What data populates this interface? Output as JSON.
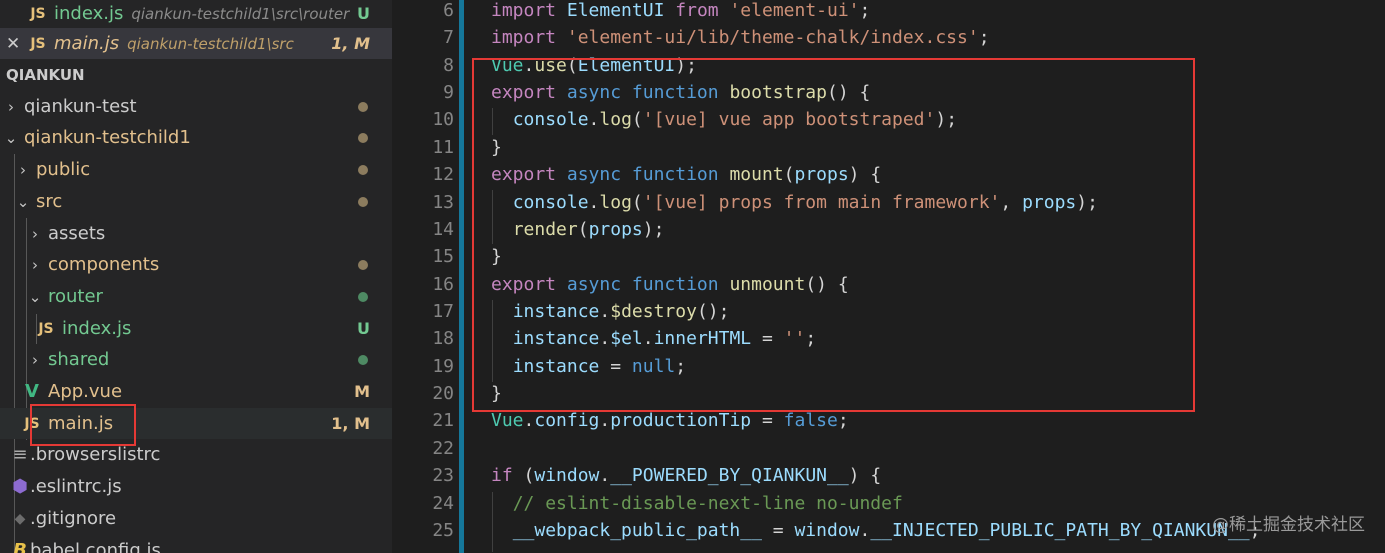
{
  "colors": {
    "keyword": "#569cd6",
    "control": "#c586c0",
    "string": "#ce9178",
    "function": "#dcdcaa",
    "variable": "#9cdcfe",
    "class": "#4ec9b0",
    "comment": "#6a9955",
    "plain": "#d4d4d4",
    "modified": "#e2c08d",
    "untracked": "#73c991",
    "highlight_box": "#e53935"
  },
  "sidebar": {
    "open_editors": [
      {
        "icon": "JS",
        "name": "index.js",
        "path": "qiankun-testchild1\\src\\router",
        "status": "U"
      },
      {
        "close": "✕",
        "icon": "JS",
        "name": "main.js",
        "path": "qiankun-testchild1\\src",
        "status": "1, M"
      }
    ],
    "section_title": "QIANKUN",
    "tree": [
      {
        "chevron": "›",
        "name": "qiankun-test"
      },
      {
        "chevron": "⌄",
        "name": "qiankun-testchild1"
      },
      {
        "chevron": "›",
        "name": "public"
      },
      {
        "chevron": "⌄",
        "name": "src"
      },
      {
        "chevron": "›",
        "name": "assets"
      },
      {
        "chevron": "›",
        "name": "components"
      },
      {
        "chevron": "⌄",
        "name": "router"
      },
      {
        "icon": "JS",
        "name": "index.js",
        "status": "U"
      },
      {
        "chevron": "›",
        "name": "shared"
      },
      {
        "icon": "V",
        "name": "App.vue",
        "status": "M"
      },
      {
        "icon": "JS",
        "name": "main.js",
        "status": "1, M"
      },
      {
        "icon": "≡",
        "name": ".browserslistrc"
      },
      {
        "icon": "⬢",
        "name": ".eslintrc.js"
      },
      {
        "icon": "◆",
        "name": ".gitignore"
      },
      {
        "icon": "B",
        "name": "babel.config.js"
      }
    ]
  },
  "editor": {
    "line_numbers": [
      "6",
      "7",
      "8",
      "9",
      "10",
      "11",
      "12",
      "13",
      "14",
      "15",
      "16",
      "17",
      "18",
      "19",
      "20",
      "21",
      "22",
      "23",
      "24",
      "25"
    ],
    "watermark": "@稀土掘金技术社区"
  }
}
